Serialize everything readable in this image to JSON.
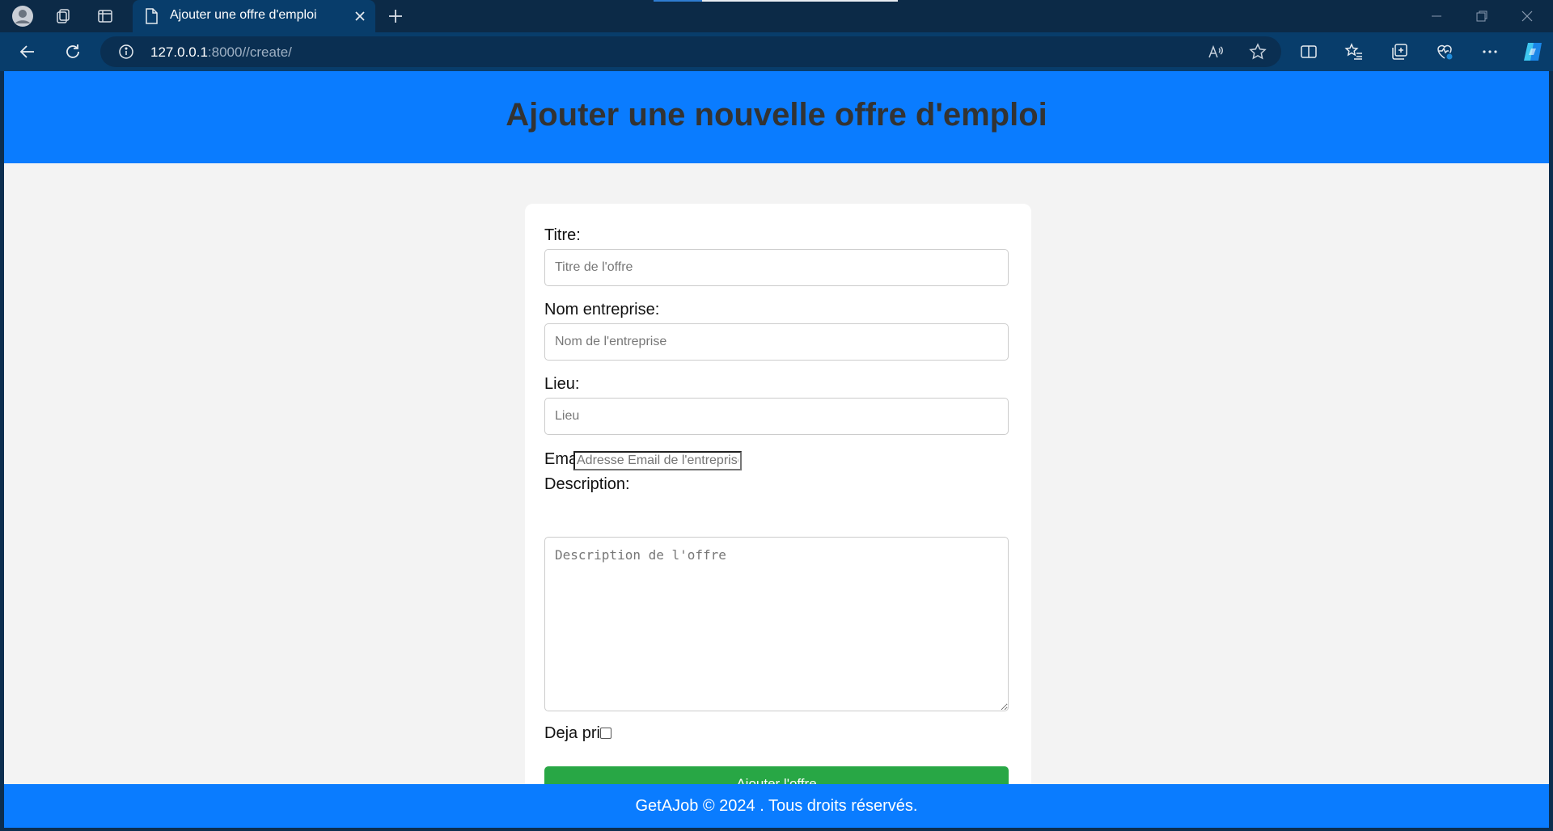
{
  "browser": {
    "tab": {
      "title": "Ajouter une offre d'emploi"
    },
    "url": {
      "host": "127.0.0.1",
      "rest": ":8000//create/"
    }
  },
  "page": {
    "header": {
      "title": "Ajouter une nouvelle offre d'emploi"
    },
    "form": {
      "titre": {
        "label": "Titre:",
        "placeholder": "Titre de l'offre"
      },
      "entreprise": {
        "label": "Nom entreprise:",
        "placeholder": "Nom de l'entreprise"
      },
      "lieu": {
        "label": "Lieu:",
        "placeholder": "Lieu"
      },
      "email": {
        "label": "Email:",
        "placeholder": "Adresse Email de l'entreprise"
      },
      "description": {
        "label": "Description:",
        "placeholder": "Description de l'offre"
      },
      "deja_pris": {
        "label": "Deja pris:",
        "checked": false
      },
      "submit_label": "Ajouter l'offre"
    },
    "footer": {
      "text": "GetAJob © 2024 . Tous droits réservés."
    }
  },
  "colors": {
    "header_bg": "#0a7cff",
    "submit_bg": "#28a745",
    "page_bg": "#f3f3f3"
  }
}
